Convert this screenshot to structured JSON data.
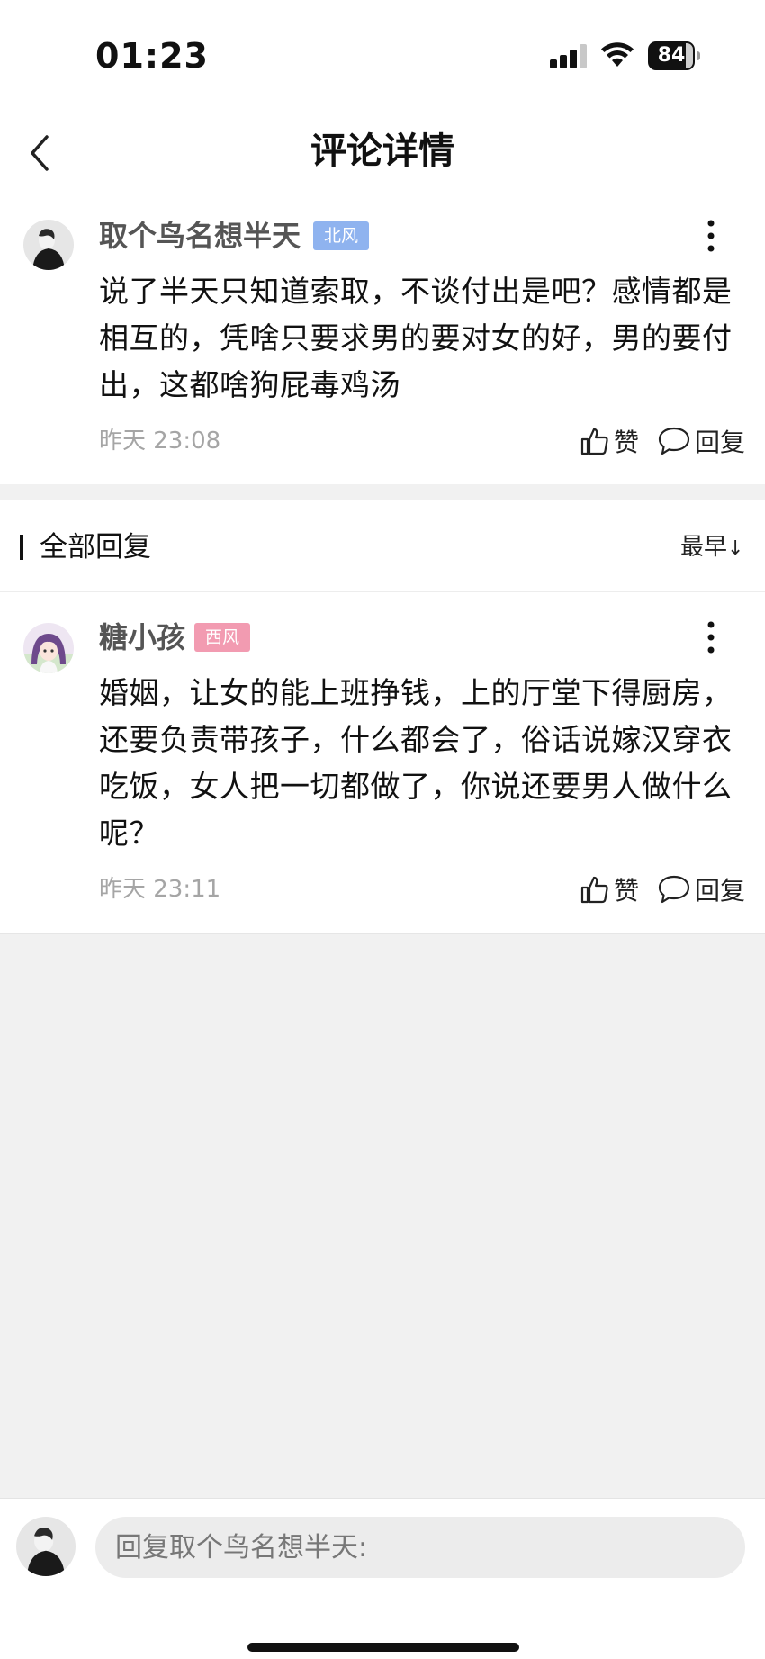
{
  "status_bar": {
    "time": "01:23",
    "battery": "84",
    "battery_level": 0.84
  },
  "header": {
    "title": "评论详情"
  },
  "main_comment": {
    "username": "取个鸟名想半天",
    "tag": "北风",
    "tag_color": "#8fb3ef",
    "text": "说了半天只知道索取，不谈付出是吧？感情都是相互的，凭啥只要求男的要对女的好，男的要付出，这都啥狗屁毒鸡汤",
    "timestamp": "昨天 23:08",
    "like_label": "赞",
    "reply_label": "回复"
  },
  "replies_section": {
    "title": "全部回复",
    "sort_label": "最早",
    "sort_icon": "↓"
  },
  "replies": [
    {
      "username": "糖小孩",
      "tag": "西风",
      "tag_color": "#f29bb1",
      "text": "婚姻，让女的能上班挣钱，上的厅堂下得厨房，还要负责带孩子，什么都会了，俗话说嫁汉穿衣吃饭，女人把一切都做了，你说还要男人做什么呢？",
      "timestamp": "昨天 23:11",
      "like_label": "赞",
      "reply_label": "回复"
    }
  ],
  "bottom_bar": {
    "reply_placeholder": "回复取个鸟名想半天:"
  },
  "colors": {
    "background": "#f1f1f1",
    "card": "#ffffff",
    "timestamp": "#a5a5a5",
    "username": "#555555"
  }
}
